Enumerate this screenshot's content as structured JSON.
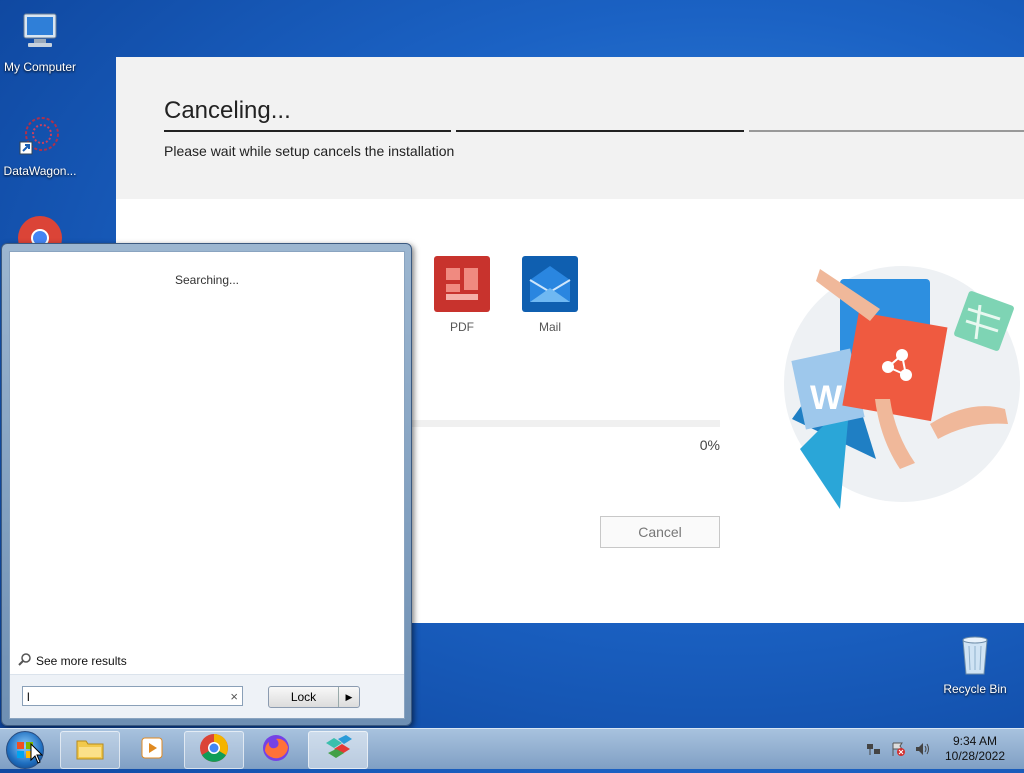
{
  "desktop": {
    "icons": [
      {
        "label": "My Computer",
        "icon": "computer-icon"
      },
      {
        "label": "DataWagon...",
        "icon": "datawagon-icon"
      },
      {
        "label": "Recycle Bin",
        "icon": "recycle-bin-icon"
      }
    ]
  },
  "installer": {
    "title": "Canceling...",
    "subtitle": "Please wait while setup cancels the installation",
    "apps": [
      {
        "label": "PDF",
        "icon": "pdf-icon",
        "color": "#c8332d"
      },
      {
        "label": "Mail",
        "icon": "mail-icon",
        "color": "#0f5fb0"
      }
    ],
    "progress_percent": "0%",
    "progress_value": 0,
    "cancel_label": "Cancel"
  },
  "start_menu": {
    "status": "Searching...",
    "see_more": "See more results",
    "search_value": "l",
    "search_clear": "×",
    "lock_label": "Lock",
    "lock_arrow": "▶"
  },
  "taskbar": {
    "items": [
      "start-orb-icon",
      "file-explorer-icon",
      "media-player-icon",
      "chrome-icon",
      "firefox-icon",
      "app-cubes-icon"
    ],
    "time": "9:34 AM",
    "date": "10/28/2022"
  },
  "colors": {
    "accent": "#2b6fd6",
    "pdf": "#c8332d",
    "mail": "#0f5fb0"
  }
}
